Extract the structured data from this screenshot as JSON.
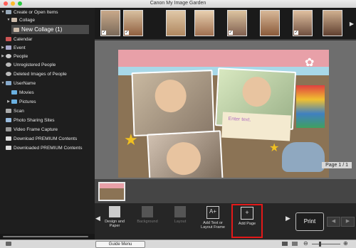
{
  "window": {
    "title": "Canon My Image Garden"
  },
  "sidebar": {
    "items": [
      {
        "label": "Create or Open Items",
        "icon": "create-icon"
      },
      {
        "label": "Collage",
        "icon": "collage-icon"
      },
      {
        "label": "New Collage (1)",
        "icon": "collage-item-icon"
      },
      {
        "label": "Calendar",
        "icon": "calendar-icon"
      },
      {
        "label": "Event",
        "icon": "event-icon"
      },
      {
        "label": "People",
        "icon": "people-icon"
      },
      {
        "label": "Unregistered People",
        "icon": "unregistered-people-icon"
      },
      {
        "label": "Deleted Images of People",
        "icon": "deleted-people-icon"
      },
      {
        "label": "UserName",
        "icon": "computer-icon"
      },
      {
        "label": "Movies",
        "icon": "folder-icon"
      },
      {
        "label": "Pictures",
        "icon": "folder-icon"
      },
      {
        "label": "Scan",
        "icon": "scan-icon"
      },
      {
        "label": "Photo Sharing Sites",
        "icon": "photo-sharing-icon"
      },
      {
        "label": "Video Frame Capture",
        "icon": "video-capture-icon"
      },
      {
        "label": "Download PREMIUM Contents",
        "icon": "download-icon"
      },
      {
        "label": "Downloaded PREMIUM Contents",
        "icon": "downloaded-icon"
      }
    ]
  },
  "canvas": {
    "placeholder_text": "Enter text.",
    "page_indicator": "Page 1 / 1"
  },
  "toolbar": {
    "design_label": "Design and Paper",
    "background_label": "Background",
    "layout_label": "Layout",
    "add_text_label": "Add Text or Layout Frame",
    "add_page_label": "Add Page",
    "print_label": "Print"
  },
  "status": {
    "guide_menu_label": "Guide Menu"
  },
  "colors": {
    "highlight": "#e31919",
    "sidebar_bg": "#1e1e1e",
    "selected_bg": "#4a4a4a"
  }
}
